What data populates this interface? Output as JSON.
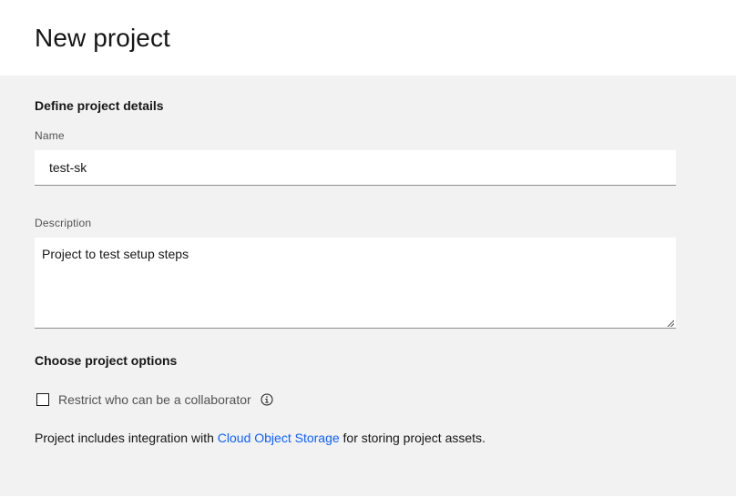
{
  "header": {
    "title": "New project"
  },
  "details": {
    "heading": "Define project details",
    "name_label": "Name",
    "name_value": "test-sk",
    "description_label": "Description",
    "description_value": "Project to test setup steps"
  },
  "options": {
    "heading": "Choose project options",
    "restrict_label": "Restrict who can be a collaborator",
    "restrict_checked": false,
    "info_icon": "info-icon",
    "integration_prefix": "Project includes integration with ",
    "integration_link": "Cloud Object Storage",
    "integration_suffix": " for storing project assets."
  },
  "colors": {
    "link": "#0f62fe",
    "panel_background": "#f2f2f2",
    "text_primary": "#161616",
    "text_secondary": "#525252"
  }
}
